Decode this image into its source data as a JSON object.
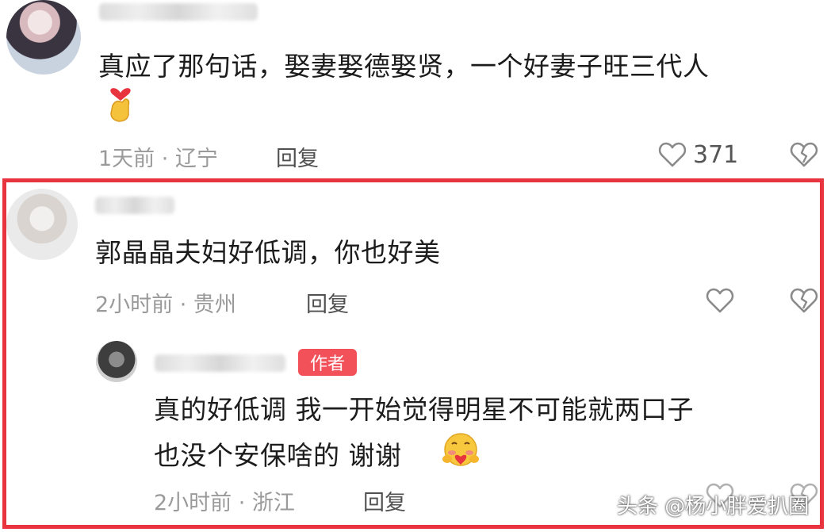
{
  "comments": [
    {
      "text_line1": "真应了那句话，娶妻娶德娶贤，一个好妻子旺三代人",
      "time_location": "1天前 · 辽宁",
      "reply_label": "回复",
      "like_count": "371",
      "emoji_icon": "heart-hands-emoji"
    },
    {
      "text_line1": "郭晶晶夫妇好低调，你也好美",
      "time_location": "2小时前 · 贵州",
      "reply_label": "回复"
    }
  ],
  "reply": {
    "author_badge": "作者",
    "text_line1": "真的好低调 我一开始觉得明星不可能就两口子",
    "text_line2": "也没个安保啥的 谢谢",
    "time_location": "2小时前 · 浙江",
    "reply_label": "回复",
    "emoji_icon": "hug-emoji"
  },
  "watermark": "头条 @杨小胖爱扒圈",
  "colors": {
    "highlight_border": "#e8343e",
    "badge": "#f2515a",
    "meta_text": "#9a9a9a"
  }
}
